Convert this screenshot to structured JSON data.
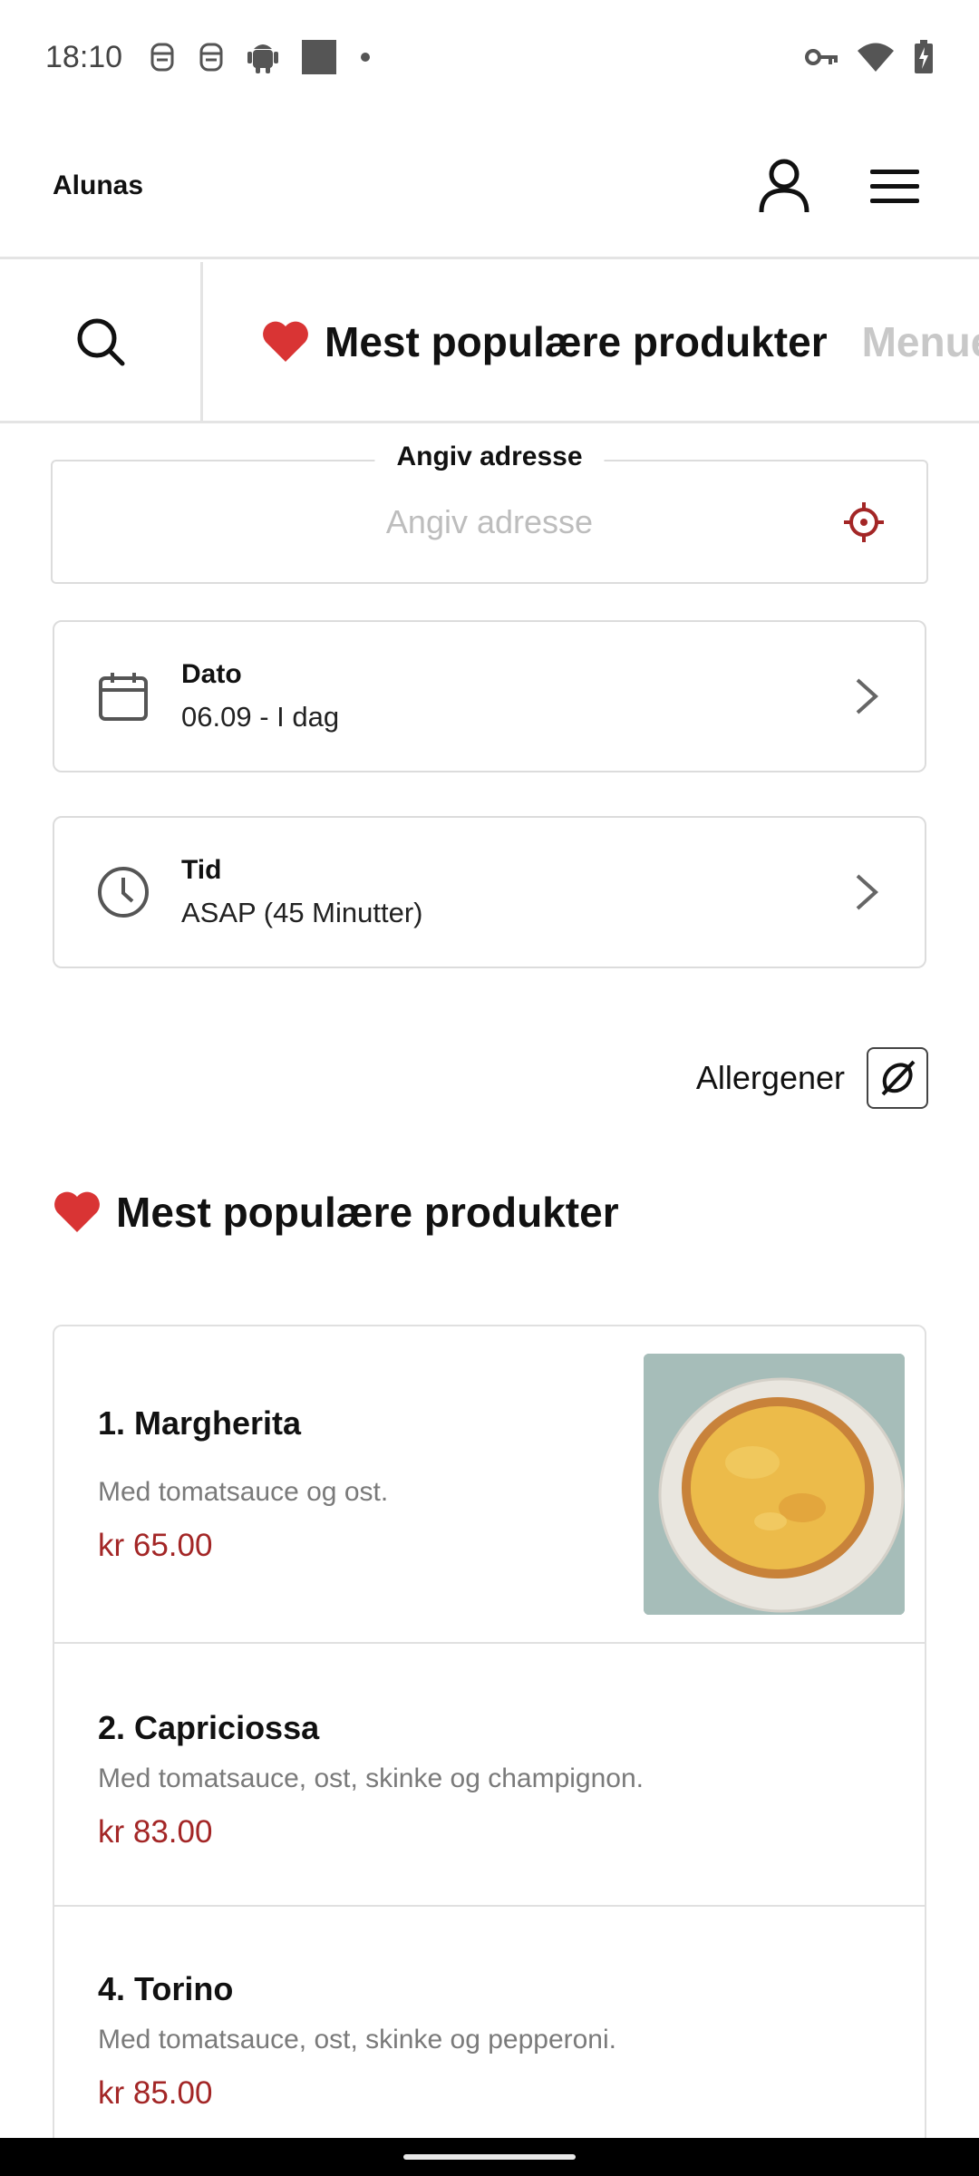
{
  "status_bar": {
    "time": "18:10",
    "left_icons": [
      "nfc-icon",
      "nfc-icon",
      "android-icon",
      "square-icon",
      "dot-icon"
    ],
    "right_icons": [
      "vpn-key-icon",
      "wifi-icon",
      "battery-charging-icon"
    ]
  },
  "header": {
    "brand": "Alunas",
    "account_icon": "person-icon",
    "menu_icon": "hamburger-menu-icon"
  },
  "category_bar": {
    "search_icon": "search-icon",
    "tabs": [
      {
        "label": "Mest populære produkter",
        "icon": "heart-icon",
        "active": true
      },
      {
        "label": "Menuen",
        "active": false
      }
    ]
  },
  "address": {
    "legend": "Angiv adresse",
    "placeholder": "Angiv adresse",
    "value": "",
    "locate_icon": "crosshair-icon"
  },
  "date_card": {
    "title": "Dato",
    "value": "06.09 - I dag",
    "icon": "calendar-icon"
  },
  "time_card": {
    "title": "Tid",
    "value": "ASAP (45 Minutter)",
    "icon": "clock-icon"
  },
  "allergens": {
    "label": "Allergener",
    "icon": "allergen-filter-icon"
  },
  "section": {
    "title": "Mest populære produkter",
    "icon": "heart-icon"
  },
  "products": [
    {
      "name": "1. Margherita",
      "description": "Med tomatsauce og ost.",
      "price": "kr 65.00",
      "has_image": true
    },
    {
      "name": "2. Capriciossa",
      "description": "Med tomatsauce, ost, skinke og champignon.",
      "price": "kr 83.00",
      "has_image": false
    },
    {
      "name": "4. Torino",
      "description": "Med tomatsauce, ost, skinke og pepperoni.",
      "price": "kr 85.00",
      "has_image": false
    }
  ],
  "colors": {
    "accent_red": "#a32626",
    "heart_red": "#d93434",
    "border": "#dcdcdc",
    "muted_text": "#7a7a7a"
  }
}
